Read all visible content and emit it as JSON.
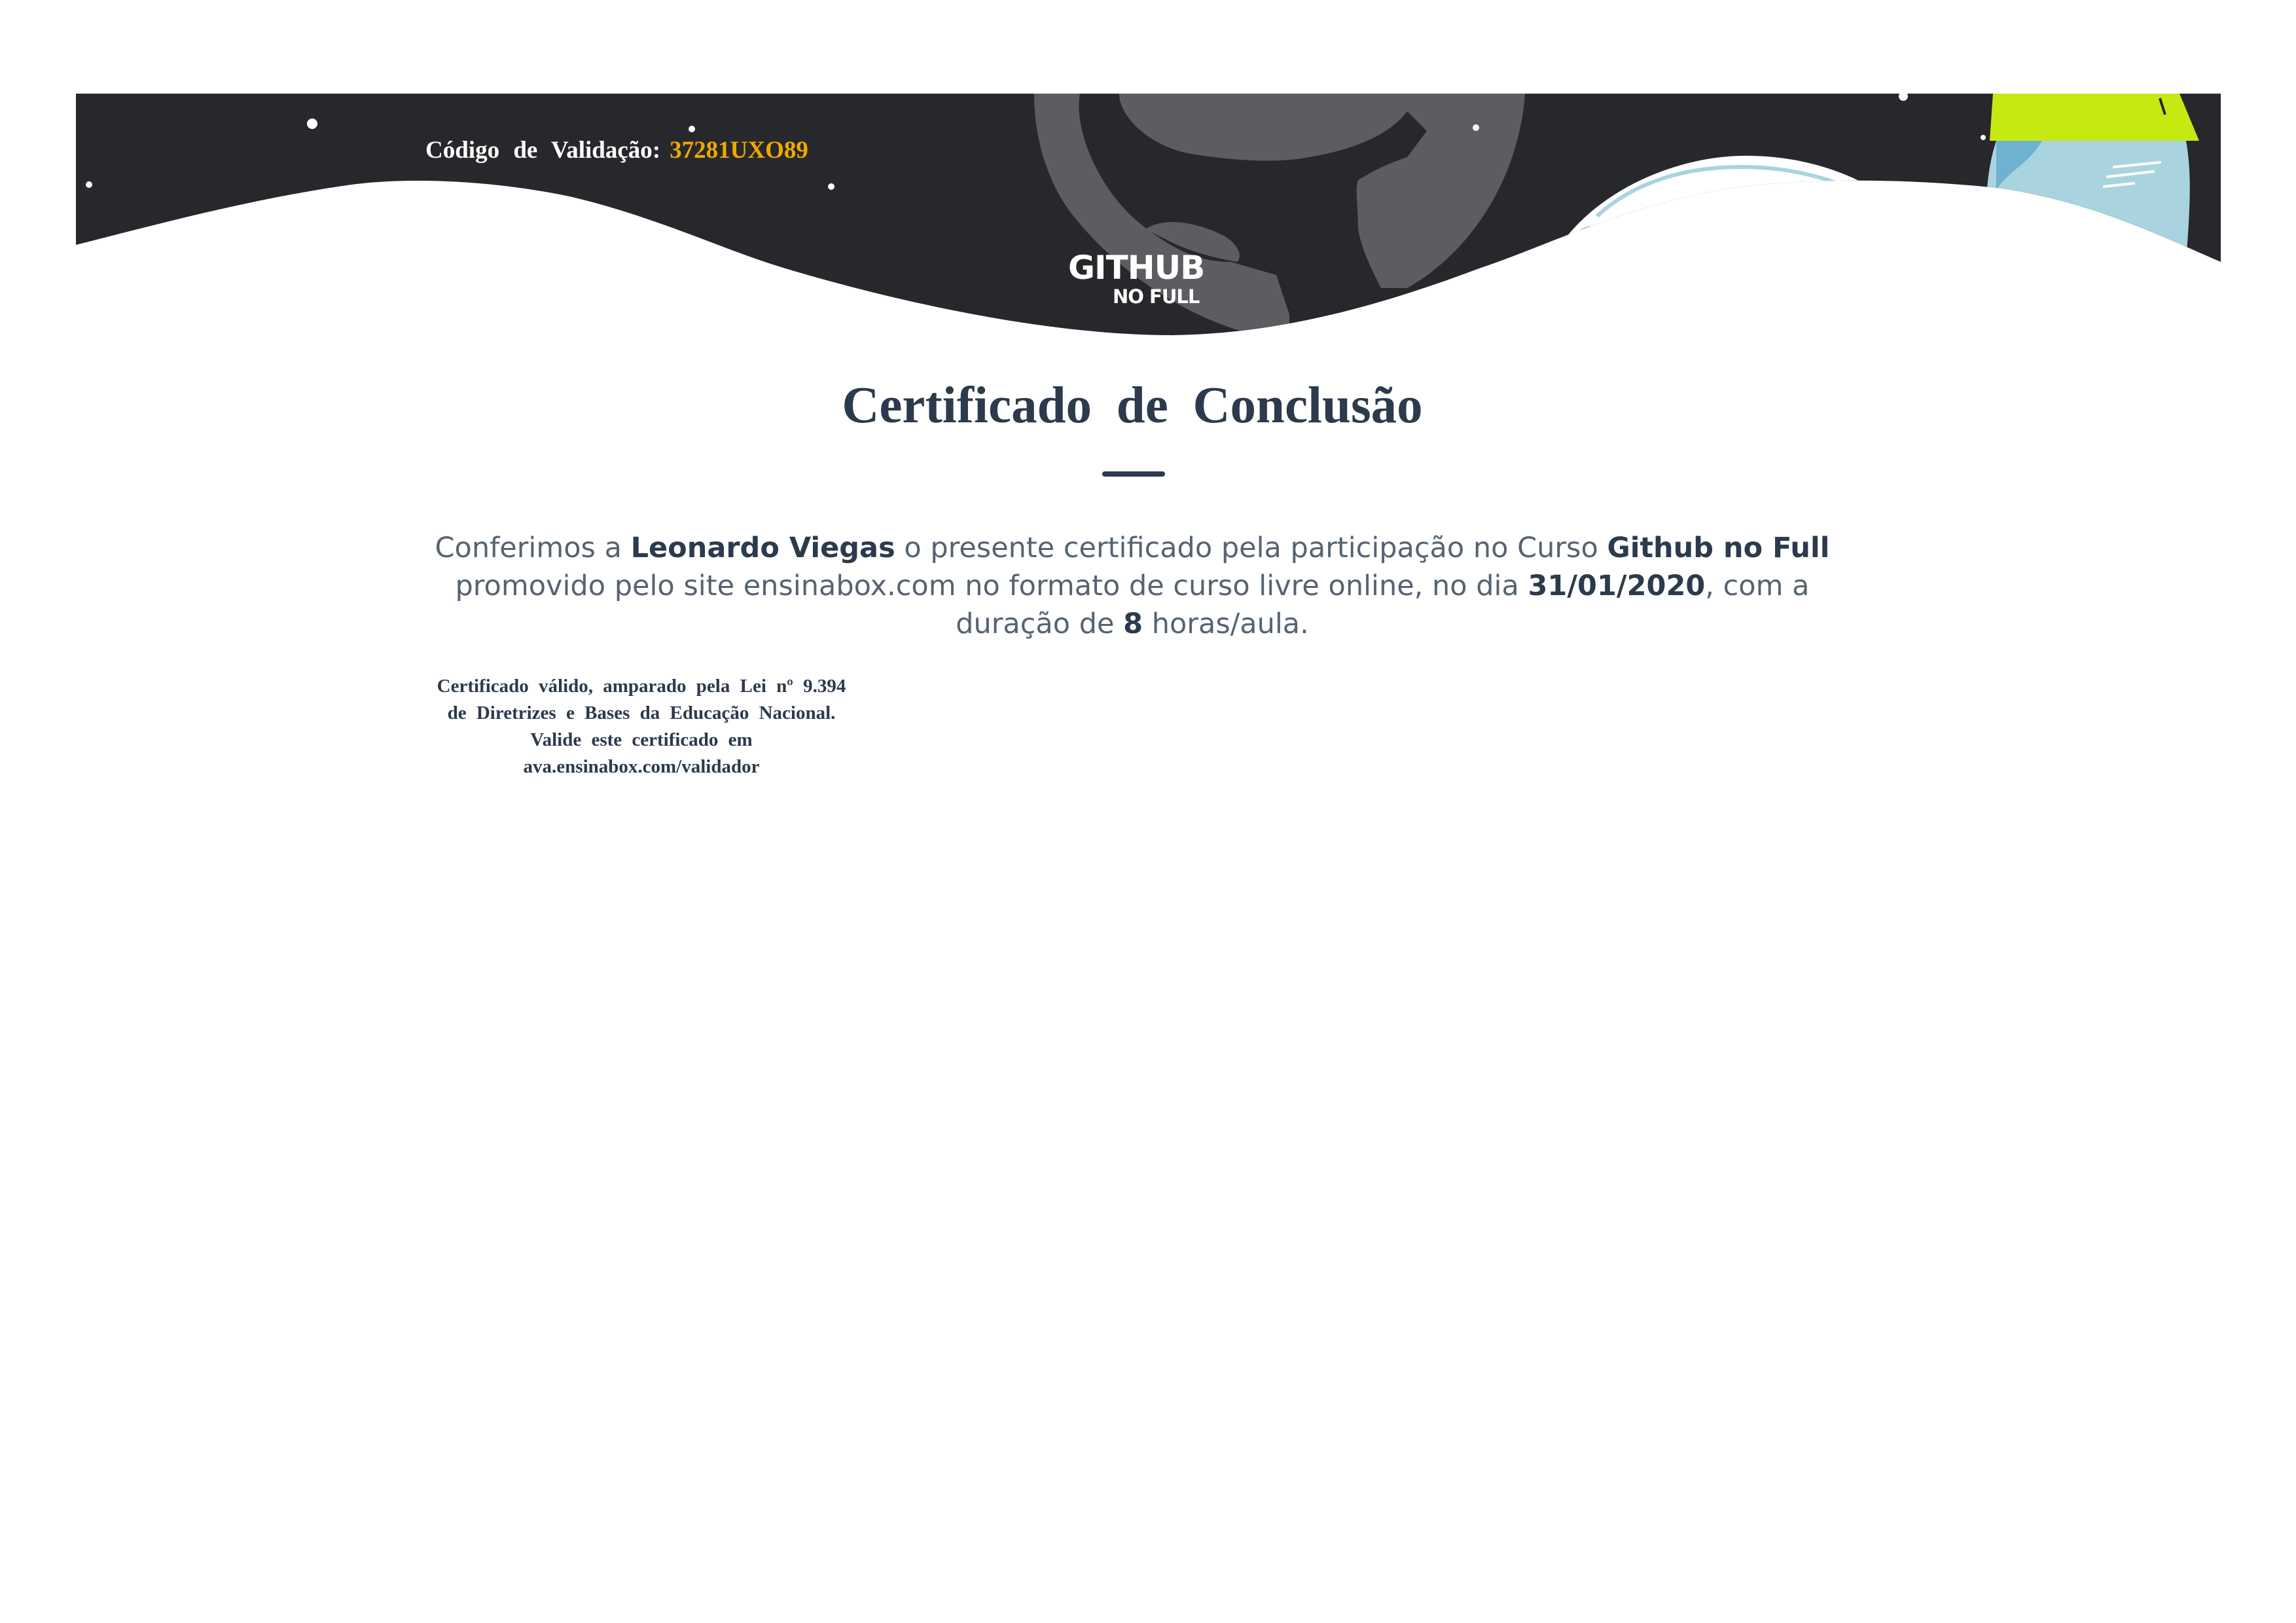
{
  "header": {
    "validation_label": "Código de Validação:",
    "validation_code": "37281UXO89",
    "logo_line1": "GITHUB",
    "logo_line2": "NO FULL"
  },
  "certificate": {
    "title": "Certificado de Conclusão",
    "intro": "Conferimos a",
    "student_name": "Leonardo Viegas",
    "text_after_name": "o presente certificado pela participação no Curso",
    "course_name": "Github no Full",
    "text_after_course": "promovido pelo site ensinabox.com no formato de curso livre online, no dia",
    "date": "31/01/2020",
    "text_after_date": ", com a duração de",
    "hours": "8",
    "hours_unit": "horas/aula."
  },
  "legal": {
    "line1": "Certificado válido, amparado pela Lei nº 9.394",
    "line2": "de Diretrizes e Bases da Educação Nacional.",
    "line3": "Valide este certificado em",
    "line4": "ava.ensinabox.com/validador"
  },
  "colors": {
    "banner_dark": "#27282b",
    "logo_gray": "#5c5d60",
    "code_accent": "#f0a800",
    "text_dark": "#2c3a4e",
    "rocket_green": "#c5ea12",
    "rocket_blue": "#a9d3df"
  },
  "icons": {
    "background_logo": "github-octocat-icon",
    "decoration": "rocket-illustration"
  }
}
